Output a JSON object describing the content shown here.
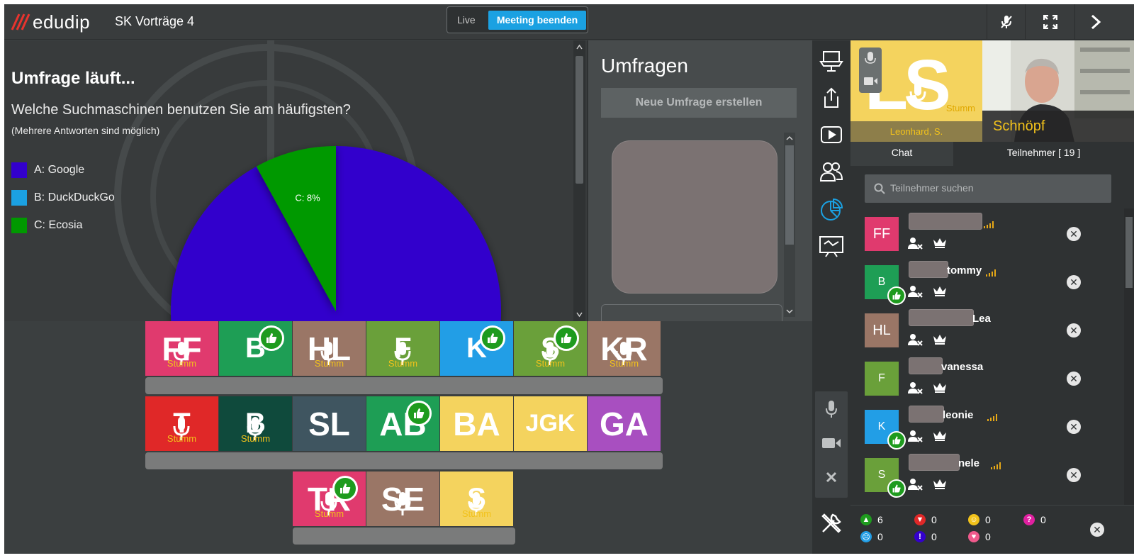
{
  "app": {
    "logo": "edudip",
    "room_title": "SK Vorträge 4",
    "live_label": "Live",
    "end_meeting_label": "Meeting beenden",
    "colors": {
      "accent": "#1ba1e2",
      "logo_red": "#e8342e",
      "stumm": "#f2c21b",
      "like": "#1e9b1e"
    }
  },
  "topbar_icons": [
    "mic-off-icon",
    "fullscreen-icon",
    "chevron-right-icon"
  ],
  "poll": {
    "heading": "Umfrage läuft...",
    "question": "Welche Suchmaschinen benutzen Sie am häufigsten?",
    "note": "(Mehrere Antworten sind möglich)"
  },
  "chart_data": {
    "type": "pie",
    "title": "",
    "categories": [
      "A: Google",
      "B: DuckDuckGo",
      "C: Ecosia"
    ],
    "values": [
      92,
      0,
      8
    ],
    "colors": [
      "#3300cc",
      "#1ba1e2",
      "#009900"
    ],
    "data_labels": [
      "",
      "",
      "C: 8%"
    ],
    "legend_placement": "left"
  },
  "polls_panel": {
    "title": "Umfragen",
    "new_poll_label": "Neue Umfrage erstellen"
  },
  "webcam_rows": [
    [
      {
        "initials": "FF",
        "color": "#e03a6e",
        "stumm": "Stumm",
        "mic": true,
        "like": false,
        "size": 46
      },
      {
        "initials": "B",
        "color": "#1e9e55",
        "stumm": "",
        "mic": false,
        "like": true,
        "size": 40
      },
      {
        "initials": "HL",
        "color": "#9a7666",
        "stumm": "Stumm",
        "mic": true,
        "like": false,
        "size": 46
      },
      {
        "initials": "F",
        "color": "#6aa03a",
        "stumm": "Stumm",
        "mic": true,
        "like": false,
        "size": 40
      },
      {
        "initials": "K",
        "color": "#229ee6",
        "stumm": "",
        "mic": false,
        "like": true,
        "size": 40
      },
      {
        "initials": "S",
        "color": "#6aa03a",
        "stumm": "Stumm",
        "mic": true,
        "like": true,
        "size": 40
      },
      {
        "initials": "KR",
        "color": "#9a7666",
        "stumm": "Stumm",
        "mic": true,
        "like": false,
        "size": 46
      }
    ],
    [
      {
        "initials": "T",
        "color": "#e02828",
        "stumm": "Stumm",
        "mic": true,
        "like": false,
        "size": 40
      },
      {
        "initials": "B",
        "color": "#0f4a3c",
        "stumm": "Stumm",
        "mic": true,
        "like": false,
        "size": 40
      },
      {
        "initials": "SL",
        "color": "#3f5560",
        "stumm": "",
        "mic": false,
        "like": false,
        "size": 46
      },
      {
        "initials": "AB",
        "color": "#1e9e55",
        "stumm": "",
        "mic": false,
        "like": true,
        "size": 46
      },
      {
        "initials": "BA",
        "color": "#f4d35e",
        "stumm": "",
        "mic": false,
        "like": false,
        "size": 46
      },
      {
        "initials": "JGK",
        "color": "#f4d35e",
        "stumm": "",
        "mic": false,
        "like": false,
        "size": 34
      },
      {
        "initials": "GA",
        "color": "#a84fc0",
        "stumm": "",
        "mic": false,
        "like": false,
        "size": 46
      }
    ],
    [
      {
        "initials": "TR",
        "color": "#e03a6e",
        "stumm": "Stumm",
        "mic": true,
        "like": true,
        "size": 46
      },
      {
        "initials": "SE",
        "color": "#9a7666",
        "stumm": "",
        "mic": true,
        "like": false,
        "size": 46
      },
      {
        "initials": "S",
        "color": "#f4d35e",
        "stumm": "Stumm",
        "mic": true,
        "like": false,
        "size": 40
      }
    ]
  ],
  "icon_column": [
    "presenter-icon",
    "share-icon",
    "video-play-icon",
    "users-icon",
    "poll-chart-icon",
    "whiteboard-icon",
    "microphone-icon",
    "camera-icon",
    "close-icon",
    "tools-icon"
  ],
  "presenter_cams": {
    "cam1": {
      "initials": "LS",
      "name": "Leonhard, S.",
      "stumm": "Stumm"
    },
    "cam2": {
      "name": "Schnöpf"
    }
  },
  "tabs": {
    "chat": "Chat",
    "participants": "Teilnehmer [ 19 ]"
  },
  "search": {
    "placeholder": "Teilnehmer suchen"
  },
  "participants": [
    {
      "initials": "FF",
      "color": "#e03a6e",
      "name": "",
      "redact_w": 104,
      "like": false
    },
    {
      "initials": "B",
      "color": "#1e9e55",
      "name": "tommy",
      "redact_w": 56,
      "like": true
    },
    {
      "initials": "HL",
      "color": "#9a7666",
      "name": "Lea",
      "redact_w": 92,
      "like": false
    },
    {
      "initials": "F",
      "color": "#6aa03a",
      "name": "vanessa",
      "redact_w": 48,
      "like": false
    },
    {
      "initials": "K",
      "color": "#229ee6",
      "name": "leonie",
      "redact_w": 50,
      "like": true
    },
    {
      "initials": "S",
      "color": "#6aa03a",
      "name": "nele",
      "redact_w": 72,
      "like": true
    }
  ],
  "reactions": [
    {
      "name": "thumbs-up",
      "color": "#1e9b1e",
      "glyph": "▲",
      "count": "6"
    },
    {
      "name": "thumbs-down",
      "color": "#e02828",
      "glyph": "▼",
      "count": "0"
    },
    {
      "name": "smile",
      "color": "#f2c21b",
      "glyph": "☺",
      "count": "0"
    },
    {
      "name": "question",
      "color": "#e020a0",
      "glyph": "?",
      "count": "0"
    },
    {
      "name": "sad",
      "color": "#229ee6",
      "glyph": "☹",
      "count": "0"
    },
    {
      "name": "exclamation",
      "color": "#3300cc",
      "glyph": "!",
      "count": "0"
    },
    {
      "name": "heart",
      "color": "#f05a8c",
      "glyph": "♥",
      "count": "0"
    }
  ]
}
